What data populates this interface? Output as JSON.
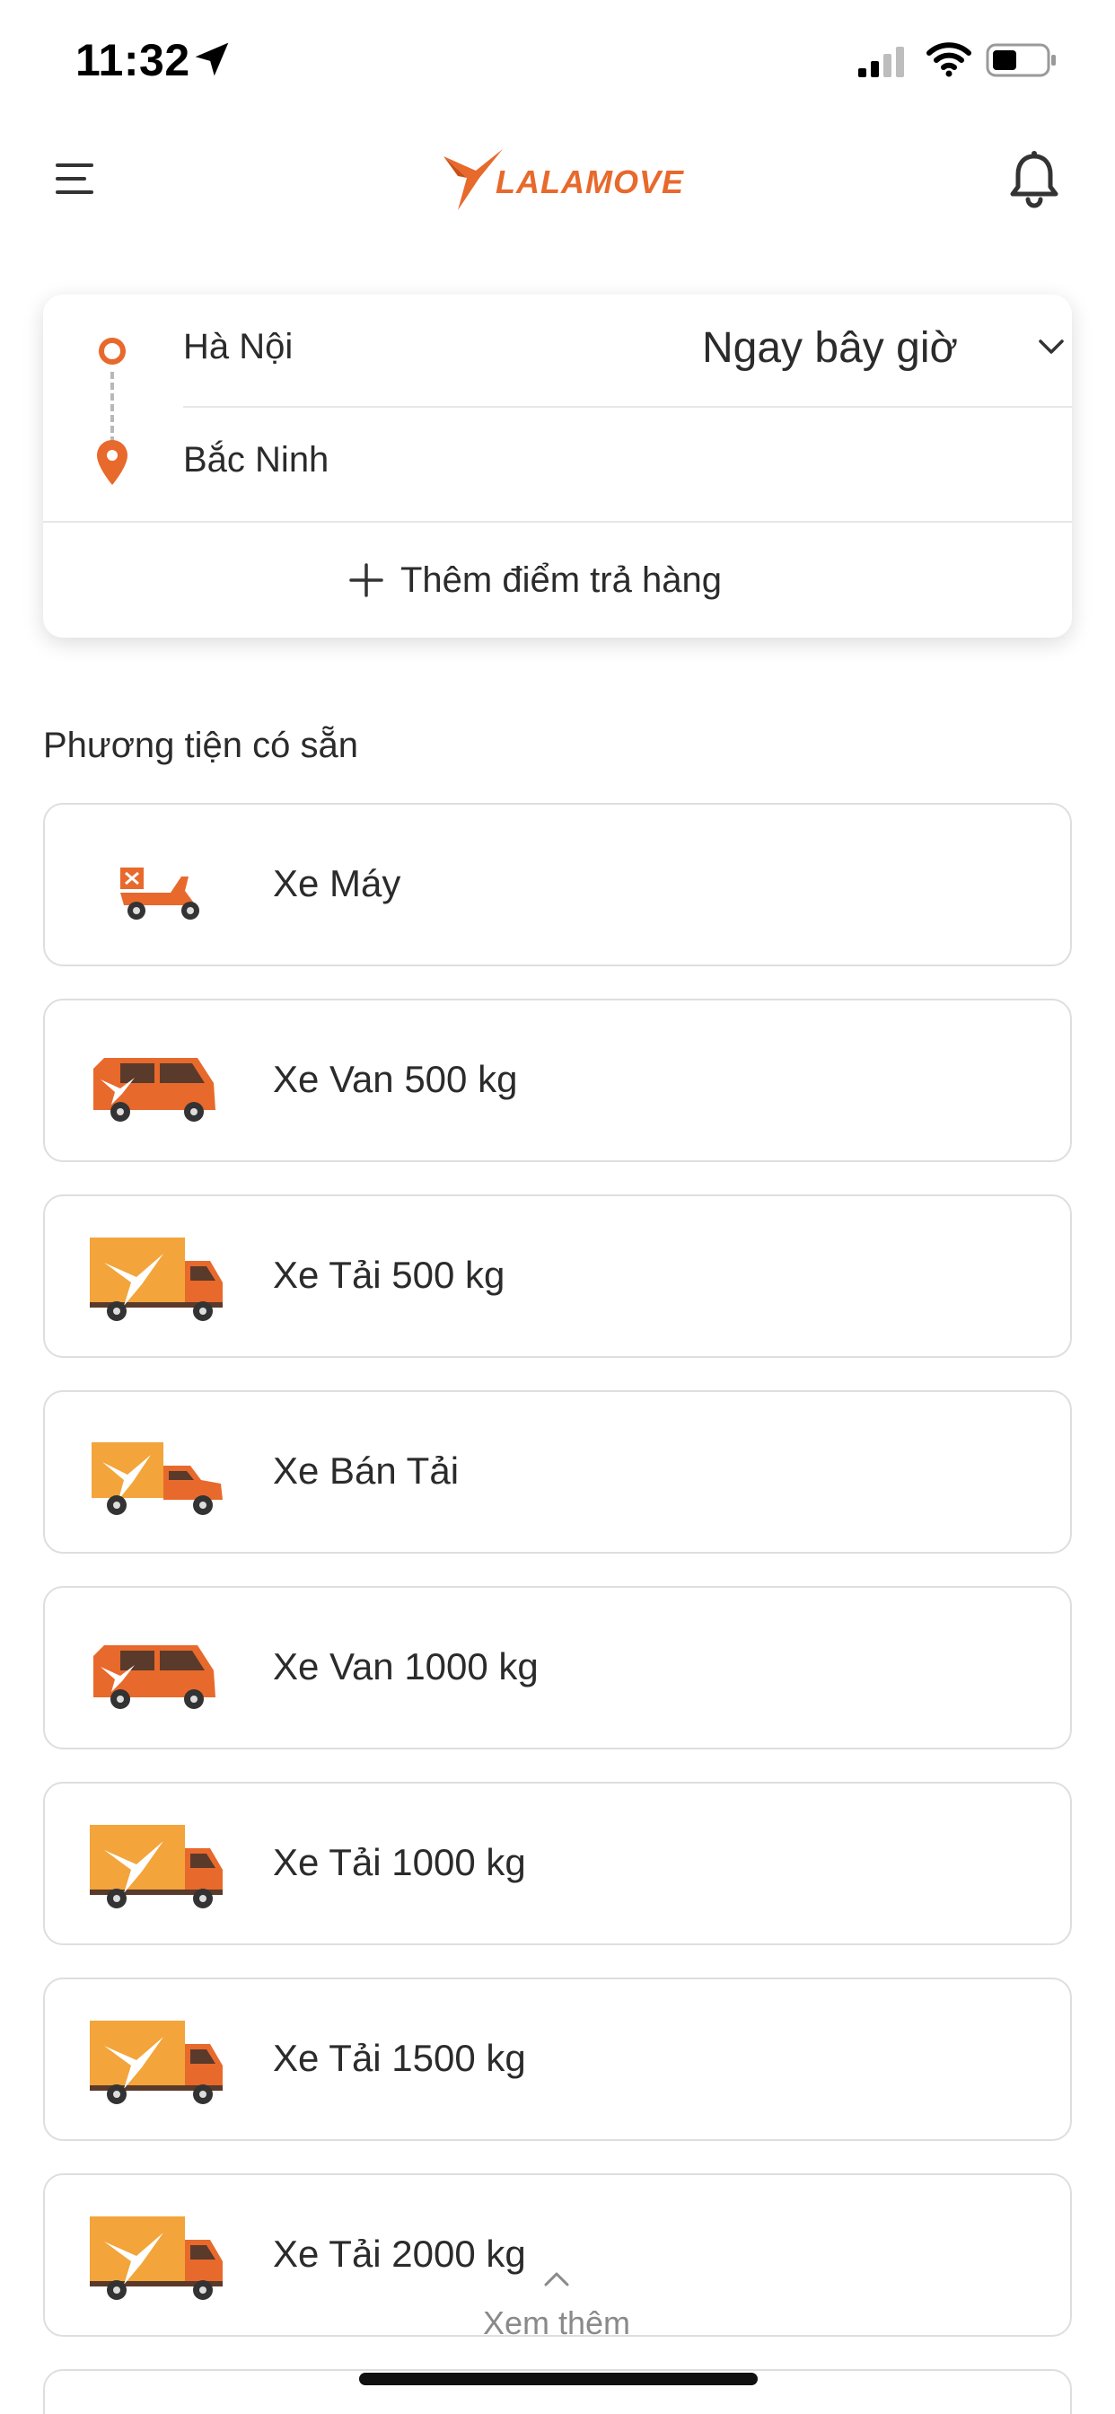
{
  "status_bar": {
    "time": "11:32"
  },
  "header": {
    "logo_text": "LALAMOVE"
  },
  "route": {
    "pickup": "Hà Nội",
    "dropoff": "Bắc Ninh",
    "time_option": "Ngay bây giờ",
    "add_stop_label": "Thêm điểm trả hàng"
  },
  "vehicles": {
    "section_title": "Phương tiện có sẵn",
    "items": [
      {
        "label": "Xe Máy",
        "icon": "motorbike-icon"
      },
      {
        "label": "Xe Van 500 kg",
        "icon": "van-icon"
      },
      {
        "label": "Xe Tải 500 kg",
        "icon": "truck-icon"
      },
      {
        "label": "Xe Bán Tải",
        "icon": "pickup-truck-icon"
      },
      {
        "label": "Xe Van 1000 kg",
        "icon": "van-icon"
      },
      {
        "label": "Xe Tải 1000 kg",
        "icon": "truck-icon"
      },
      {
        "label": "Xe Tải 1500 kg",
        "icon": "truck-icon"
      },
      {
        "label": "Xe Tải 2000 kg",
        "icon": "truck-icon"
      }
    ]
  },
  "see_more_label": "Xem thêm",
  "colors": {
    "brand": "#e8692c",
    "truck_box": "#f3a43b",
    "text": "#2b2b2b",
    "border": "#dedede"
  }
}
